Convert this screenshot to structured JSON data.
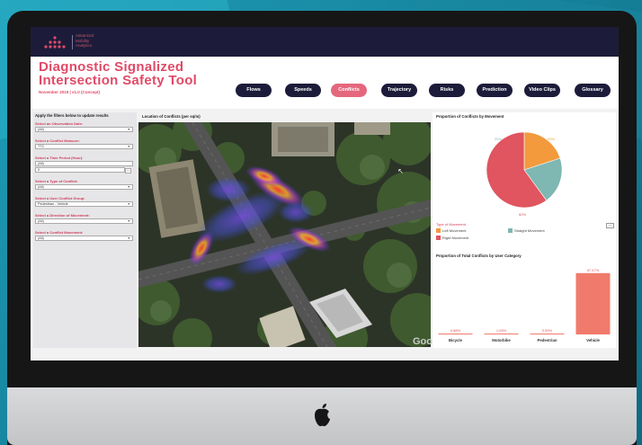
{
  "brand": {
    "logo_line1": "Advanced",
    "logo_line2": "Mobility",
    "logo_line3": "Analytics",
    "accent_color": "#e04a67",
    "dark_color": "#1c1c3a"
  },
  "header": {
    "title_line1": "Diagnostic Signalized",
    "title_line2": "Intersection Safety Tool",
    "subtitle": "November 2019  |  v1.0 (Concept)"
  },
  "nav": {
    "items": [
      {
        "label": "Flows",
        "active": false
      },
      {
        "label": "Speeds",
        "active": false
      },
      {
        "label": "Conflicts",
        "active": true
      },
      {
        "label": "Trajectory",
        "active": false
      },
      {
        "label": "Risks",
        "active": false
      },
      {
        "label": "Prediction",
        "active": false
      },
      {
        "label": "Video Clips",
        "active": false
      },
      {
        "label": "Glossary",
        "active": false
      }
    ]
  },
  "filters": {
    "heading": "Apply the filters below to update results",
    "date_label": "Select an Observation Date:",
    "date_value": "(All)",
    "measure_label": "Select a Conflict Measure:",
    "measure_value": "TTC",
    "time_label": "Select a Time Period (Hour):",
    "time_value": "(All)",
    "time_value2": "0",
    "type_label": "Select a Type of Conflict:",
    "type_value": "(All)",
    "group_label": "Select a User Conflict Group:",
    "group_value": "Pedestrian - Vehicle",
    "direction_label": "Select a Direction of Movement:",
    "direction_value": "(All)",
    "movement_label": "Select a Conflict Movement:",
    "movement_value": "(All)"
  },
  "map": {
    "title": "Location of Conflicts (per sq/m)",
    "attribution": "Goo"
  },
  "pie": {
    "title": "Proportion of Conflicts by Movement",
    "legend_title": "Type of Movement",
    "legend_items": [
      "Left Movement",
      "Straight Movement",
      "Right Movement"
    ],
    "labels": [
      "20%",
      "20%",
      "60%"
    ]
  },
  "bars": {
    "title": "Proportion of Total Conflicts by User Category"
  },
  "chart_data": [
    {
      "type": "pie",
      "title": "Proportion of Conflicts by Movement",
      "categories": [
        "Left Movement",
        "Straight Movement",
        "Right Movement"
      ],
      "values": [
        20,
        20,
        60
      ],
      "colors": [
        "#f29a3c",
        "#7fb7b2",
        "#e0555f"
      ],
      "legend_placement": "bottom-left"
    },
    {
      "type": "bar",
      "title": "Proportion of Total Conflicts by User Category",
      "categories": [
        "Bicycle",
        "Motorbike",
        "Pedestrian",
        "Vehicle"
      ],
      "values": [
        0.88,
        1.05,
        0.59,
        97.47
      ],
      "value_labels": [
        "0.88%",
        "1.05%",
        "0.59%",
        "97.47%"
      ],
      "color": "#f07b6c",
      "ylim": [
        0,
        100
      ],
      "grid": false
    }
  ]
}
